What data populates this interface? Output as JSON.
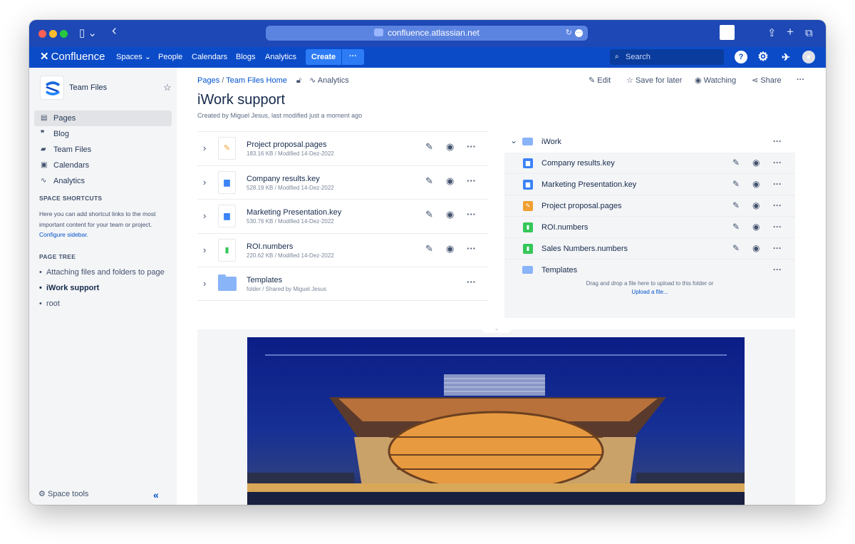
{
  "browser": {
    "url": "confluence.atlassian.net",
    "back": "‹",
    "sidebar_toggle": "▯ ⌄",
    "share": "⇪",
    "new_tab": "+",
    "tabs": "⧉",
    "reload": "↻"
  },
  "nav": {
    "brand": "Confluence",
    "items": [
      "Spaces ⌄",
      "People",
      "Calendars",
      "Blogs",
      "Analytics"
    ],
    "create": "Create",
    "create_more": "···",
    "search_placeholder": "Search",
    "icons": [
      "help-icon",
      "settings-icon",
      "notifications-icon",
      "profile-icon"
    ]
  },
  "sidebar": {
    "space_name": "Team Files",
    "items": [
      {
        "label": "Pages",
        "icon": "pages-icon",
        "active": true
      },
      {
        "label": "Blog",
        "icon": "blog-icon"
      },
      {
        "label": "Team Files",
        "icon": "folder-icon"
      },
      {
        "label": "Calendars",
        "icon": "calendar-icon"
      },
      {
        "label": "Analytics",
        "icon": "analytics-icon"
      }
    ],
    "shortcuts_heading": "SPACE SHORTCUTS",
    "shortcuts_text": "Here you can add shortcut links to the most important content for your team or project.",
    "configure_link": "Configure sidebar.",
    "page_tree_heading": "PAGE TREE",
    "tree": [
      "Attaching files and folders to page",
      "iWork support",
      "root"
    ],
    "space_tools": "Space tools",
    "collapse": "«"
  },
  "breadcrumb": {
    "pages": "Pages",
    "separator": "/",
    "team_files_home": "Team Files Home",
    "analytics": "Analytics"
  },
  "page_actions": {
    "edit": "Edit",
    "save_for_later": "Save for later",
    "watching": "Watching",
    "share": "Share",
    "more": "···"
  },
  "page": {
    "title": "iWork support",
    "byline": "Created by Miguel Jesus, last modified just a moment ago"
  },
  "files": [
    {
      "name": "Project proposal.pages",
      "meta": "183.16 KB / Modified 14-Dez-2022",
      "type": "pages",
      "glyph": "✎",
      "color": "#f0a030",
      "editable": true
    },
    {
      "name": "Company results.key",
      "meta": "528.19 KB / Modified 14-Dez-2022",
      "type": "key",
      "glyph": "▆",
      "color": "#3b82f6",
      "editable": true
    },
    {
      "name": "Marketing Presentation.key",
      "meta": "530.76 KB / Modified 14-Dez-2022",
      "type": "key",
      "glyph": "▆",
      "color": "#3b82f6",
      "editable": true
    },
    {
      "name": "ROI.numbers",
      "meta": "220.62 KB / Modified 14-Dez-2022",
      "type": "numbers",
      "glyph": "▮",
      "color": "#34c759",
      "editable": true
    },
    {
      "name": "Templates",
      "meta": "folder / Shared by Miguel Jesus",
      "type": "folder",
      "editable": false
    }
  ],
  "folder_panel": {
    "title": "iWork",
    "items": [
      {
        "name": "Company results.key",
        "color": "#3b82f6",
        "glyph": "▆",
        "editable": true
      },
      {
        "name": "Marketing Presentation.key",
        "color": "#3b82f6",
        "glyph": "▆",
        "editable": true
      },
      {
        "name": "Project proposal.pages",
        "color": "#f0a030",
        "glyph": "✎",
        "editable": true
      },
      {
        "name": "ROI.numbers",
        "color": "#34c759",
        "glyph": "▮",
        "editable": true
      },
      {
        "name": "Sales Numbers.numbers",
        "color": "#34c759",
        "glyph": "▮",
        "editable": true
      },
      {
        "name": "Templates",
        "folder": true,
        "editable": false
      }
    ],
    "drop_text": "Drag and drop a file here to upload to this folder or",
    "upload_link": "Upload a file..."
  },
  "icons": {
    "edit": "✎",
    "view": "◉",
    "more": "···",
    "expand": "›",
    "collapse": "⌄"
  }
}
